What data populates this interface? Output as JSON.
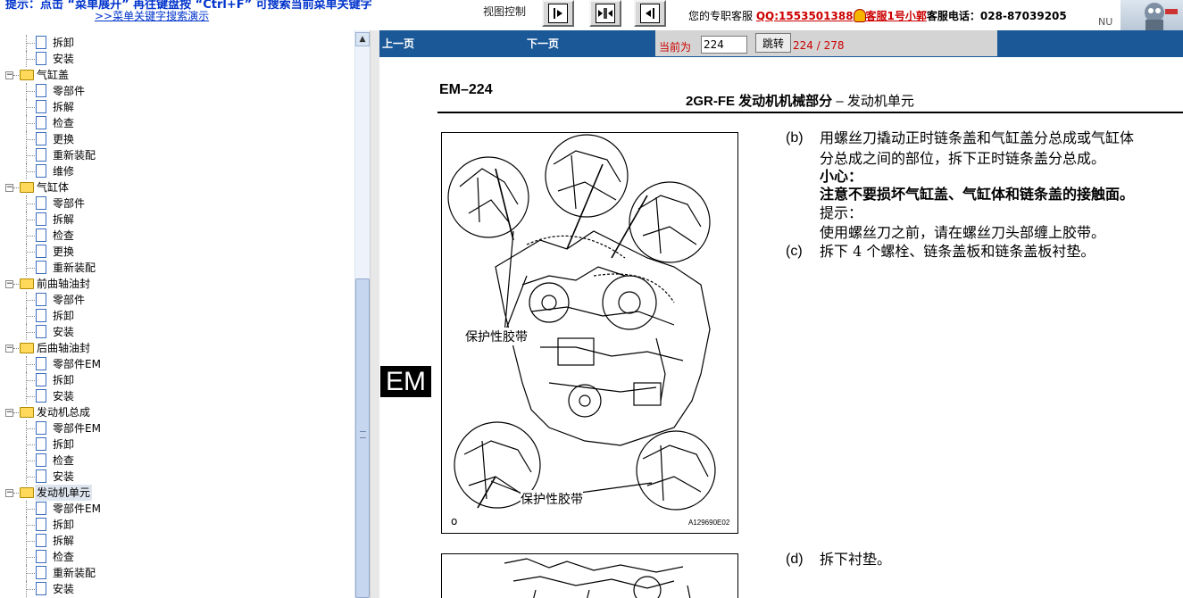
{
  "topbar": {
    "tip": "提示：点击 “菜单展开” 再往键盘按 “Ctrl+F” 可搜索当前菜单关键字",
    "demo_link": ">>菜单关键字搜索演示",
    "view_control_label": "视图控制",
    "service": {
      "prefix": "您的专职客服",
      "qq": "QQ:1553501388",
      "agent": "客服1号小郭",
      "tel_label": "客服电话：",
      "tel": "028-87039205"
    },
    "corner_text": "NU"
  },
  "tree": [
    {
      "label": "拆卸",
      "type": "page"
    },
    {
      "label": "安装",
      "type": "page"
    },
    {
      "label": "气缸盖",
      "type": "folder"
    },
    {
      "label": "零部件",
      "type": "page"
    },
    {
      "label": "拆解",
      "type": "page"
    },
    {
      "label": "检查",
      "type": "page"
    },
    {
      "label": "更换",
      "type": "page"
    },
    {
      "label": "重新装配",
      "type": "page"
    },
    {
      "label": "维修",
      "type": "page"
    },
    {
      "label": "气缸体",
      "type": "folder"
    },
    {
      "label": "零部件",
      "type": "page"
    },
    {
      "label": "拆解",
      "type": "page"
    },
    {
      "label": "检查",
      "type": "page"
    },
    {
      "label": "更换",
      "type": "page"
    },
    {
      "label": "重新装配",
      "type": "page"
    },
    {
      "label": "前曲轴油封",
      "type": "folder"
    },
    {
      "label": "零部件",
      "type": "page"
    },
    {
      "label": "拆卸",
      "type": "page"
    },
    {
      "label": "安装",
      "type": "page"
    },
    {
      "label": "后曲轴油封",
      "type": "folder"
    },
    {
      "label": "零部件EM",
      "type": "page"
    },
    {
      "label": "拆卸",
      "type": "page"
    },
    {
      "label": "安装",
      "type": "page"
    },
    {
      "label": "发动机总成",
      "type": "folder"
    },
    {
      "label": "零部件EM",
      "type": "page"
    },
    {
      "label": "拆卸",
      "type": "page"
    },
    {
      "label": "检查",
      "type": "page"
    },
    {
      "label": "安装",
      "type": "page"
    },
    {
      "label": "发动机单元",
      "type": "folder",
      "selected": true
    },
    {
      "label": "零部件EM",
      "type": "page"
    },
    {
      "label": "拆卸",
      "type": "page"
    },
    {
      "label": "拆解",
      "type": "page"
    },
    {
      "label": "检查",
      "type": "page"
    },
    {
      "label": "重新装配",
      "type": "page"
    },
    {
      "label": "安装",
      "type": "page"
    }
  ],
  "nav": {
    "prev": "上一页",
    "next": "下一页",
    "current_label": "当前为",
    "page_value": "224",
    "jump_button": "跳转",
    "page_count": "224 / 278"
  },
  "doc": {
    "side_tab": "EM",
    "page_code": "EM–224",
    "header_bold": "2GR-FE 发动机机械部分",
    "header_rest": " – 发动机单元",
    "figure": {
      "label_top": "保护性胶带",
      "label_bottom": "保护性胶带",
      "code": "A129690E02",
      "mark": "o"
    },
    "steps": {
      "b_mark": "(b)",
      "b_line1": "用螺丝刀撬动正时链条盖和气缸盖分总成或气缸体",
      "b_line2": "分总成之间的部位，拆下正时链条盖分总成。",
      "caution_title": "小心：",
      "caution_text": "注意不要损坏气缸盖、气缸体和链条盖的接触面。",
      "hint_title": "提示：",
      "hint_text": "使用螺丝刀之前，请在螺丝刀头部缠上胶带。",
      "c_mark": "(c)",
      "c_text": "拆下 4 个螺栓、链条盖板和链条盖板衬垫。",
      "d_mark": "(d)",
      "d_text": "拆下衬垫。"
    }
  }
}
